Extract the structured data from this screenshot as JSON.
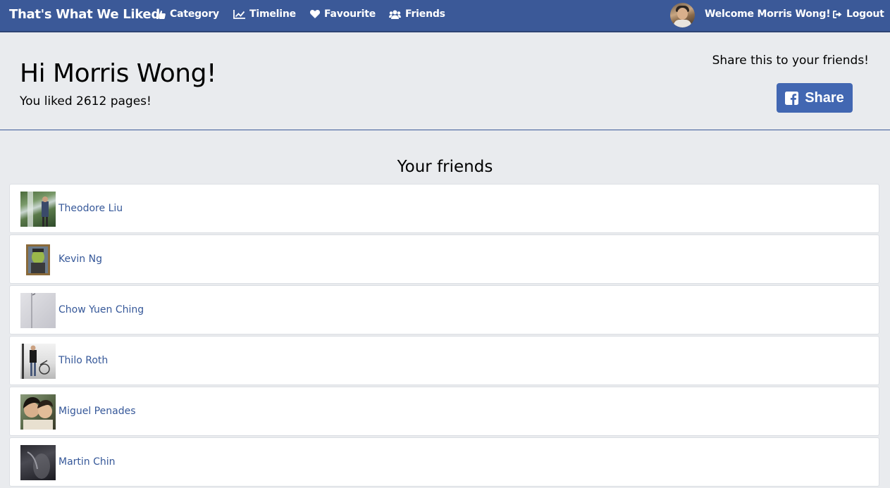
{
  "nav": {
    "brand": "That's What We Liked",
    "items": [
      {
        "label": "Category",
        "icon": "thumbs-up-icon"
      },
      {
        "label": "Timeline",
        "icon": "line-chart-icon"
      },
      {
        "label": "Favourite",
        "icon": "heart-icon"
      },
      {
        "label": "Friends",
        "icon": "users-icon"
      }
    ],
    "welcome": "Welcome Morris Wong!",
    "logout": "Logout",
    "colors": {
      "bar": "#3b5998",
      "text": "#ffffff"
    }
  },
  "hero": {
    "title": "Hi Morris Wong!",
    "subtitle": "You liked 2612 pages!",
    "share_prompt": "Share this to your friends!",
    "share_button": "Share",
    "share_color": "#4267b2"
  },
  "friends": {
    "title": "Your friends",
    "list": [
      {
        "name": "Theodore Liu"
      },
      {
        "name": "Kevin Ng"
      },
      {
        "name": "Chow Yuen Ching"
      },
      {
        "name": "Thilo Roth"
      },
      {
        "name": "Miguel Penades"
      },
      {
        "name": "Martin Chin"
      }
    ],
    "link_color": "#365899"
  }
}
